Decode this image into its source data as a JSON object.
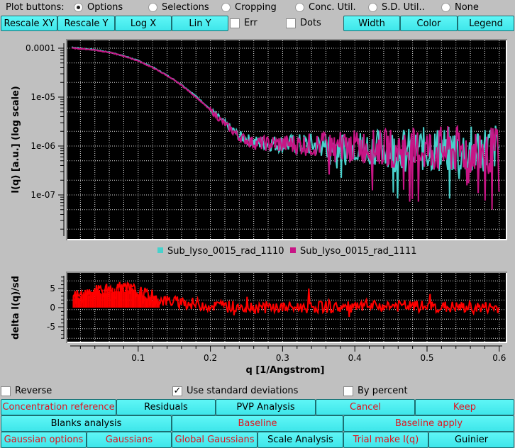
{
  "plot_buttons": {
    "label": "Plot buttons:",
    "options": [
      {
        "label": "Options",
        "selected": true
      },
      {
        "label": "Selections",
        "selected": false
      },
      {
        "label": "Cropping",
        "selected": false
      },
      {
        "label": "Conc. Util.",
        "selected": false
      },
      {
        "label": "S.D. Util..",
        "selected": false
      },
      {
        "label": "None",
        "selected": false
      }
    ]
  },
  "toolbar": {
    "rescale_xy": "Rescale XY",
    "rescale_y": "Rescale Y",
    "log_x": "Log X",
    "lin_y": "Lin Y",
    "err": {
      "label": "Err",
      "checked": false
    },
    "dots": {
      "label": "Dots",
      "checked": false
    },
    "width": "Width",
    "color": "Color",
    "legend": "Legend"
  },
  "colors": {
    "series1": "#48d1cc",
    "series2": "#c71585",
    "residual": "#ff0000",
    "button_bg": "#48f0f2",
    "red_text": "#e0141e"
  },
  "options": {
    "reverse": {
      "label": "Reverse",
      "checked": false
    },
    "use_sd": {
      "label": "Use standard deviations",
      "checked": true
    },
    "by_percent": {
      "label": "By percent",
      "checked": false
    }
  },
  "bottom_buttons": {
    "row1": [
      {
        "label": "Concentration reference",
        "red": true
      },
      {
        "label": "Residuals",
        "red": false
      },
      {
        "label": "PVP Analysis",
        "red": false
      },
      {
        "label": "Cancel",
        "red": true
      },
      {
        "label": "Keep",
        "red": true
      }
    ],
    "row2": [
      {
        "label": "Blanks analysis",
        "red": false
      },
      {
        "label": "Baseline",
        "red": true
      },
      {
        "label": "Baseline apply",
        "red": true
      }
    ],
    "row3": [
      {
        "label": "Gaussian options",
        "red": true
      },
      {
        "label": "Gaussians",
        "red": true
      },
      {
        "label": "Global Gaussians",
        "red": true
      },
      {
        "label": "Scale Analysis",
        "red": false
      },
      {
        "label": "Trial make I(q)",
        "red": true
      },
      {
        "label": "Guinier",
        "red": false
      }
    ]
  },
  "chart_data": [
    {
      "type": "line",
      "title": "",
      "xlabel": "",
      "ylabel": "I(q) [a.u.] (log scale)",
      "yscale": "log",
      "xlim": [
        0.0,
        0.61
      ],
      "ylim": [
        2e-08,
        0.00015
      ],
      "yticks": [
        "0.0001",
        "1e-05",
        "1e-06",
        "1e-07"
      ],
      "grid": true,
      "legend": {
        "position": "bottom-center",
        "entries": [
          "Sub_lyso_0015_rad_1110",
          "Sub_lyso_0015_rad_1111"
        ]
      },
      "series": [
        {
          "name": "Sub_lyso_0015_rad_1110",
          "x": [
            0.008,
            0.02,
            0.04,
            0.06,
            0.08,
            0.1,
            0.12,
            0.14,
            0.16,
            0.18,
            0.2,
            0.22,
            0.24,
            0.26,
            0.3,
            0.35,
            0.4,
            0.45,
            0.5,
            0.55,
            0.6
          ],
          "y": [
            0.000105,
            9.9e-05,
            9.3e-05,
            8.3e-05,
            7e-05,
            5.6e-05,
            4.1e-05,
            2.8e-05,
            1.8e-05,
            1.05e-05,
            5.6e-06,
            2.9e-06,
            1.6e-06,
            1.2e-06,
            1.1e-06,
            1.05e-06,
            1e-06,
            9e-07,
            8.5e-07,
            8e-07,
            1e-06
          ]
        },
        {
          "name": "Sub_lyso_0015_rad_1111",
          "x": [
            0.008,
            0.02,
            0.04,
            0.06,
            0.08,
            0.1,
            0.12,
            0.14,
            0.16,
            0.18,
            0.2,
            0.22,
            0.24,
            0.26,
            0.3,
            0.35,
            0.4,
            0.45,
            0.5,
            0.55,
            0.6
          ],
          "y": [
            0.0001,
            9.8e-05,
            9.2e-05,
            8.2e-05,
            6.9e-05,
            5.5e-05,
            4e-05,
            2.75e-05,
            1.75e-05,
            1e-05,
            5.4e-06,
            2.8e-06,
            1.55e-06,
            1.15e-06,
            1.1e-06,
            1.05e-06,
            1e-06,
            9e-07,
            8.5e-07,
            8e-07,
            8e-07
          ]
        }
      ]
    },
    {
      "type": "line",
      "title": "",
      "xlabel": "q [1/Angstrom]",
      "ylabel": "delta I(q)/sd",
      "xlim": [
        0.0,
        0.61
      ],
      "ylim": [
        -8,
        8
      ],
      "xticks": [
        "0.1",
        "0.2",
        "0.3",
        "0.4",
        "0.5",
        "0.6"
      ],
      "yticks": [
        "5",
        "0",
        "-5"
      ],
      "grid": true,
      "series": [
        {
          "name": "residuals",
          "x": [
            0.01,
            0.03,
            0.05,
            0.07,
            0.09,
            0.11,
            0.13,
            0.15,
            0.2,
            0.25,
            0.3,
            0.35,
            0.4,
            0.45,
            0.5,
            0.55,
            0.6
          ],
          "y": [
            2.5,
            3.5,
            4.0,
            4.5,
            4.5,
            3.0,
            2.0,
            1.5,
            0.5,
            0.2,
            0.0,
            0.2,
            0.0,
            0.5,
            0.2,
            0.0,
            0.0
          ]
        }
      ]
    }
  ]
}
